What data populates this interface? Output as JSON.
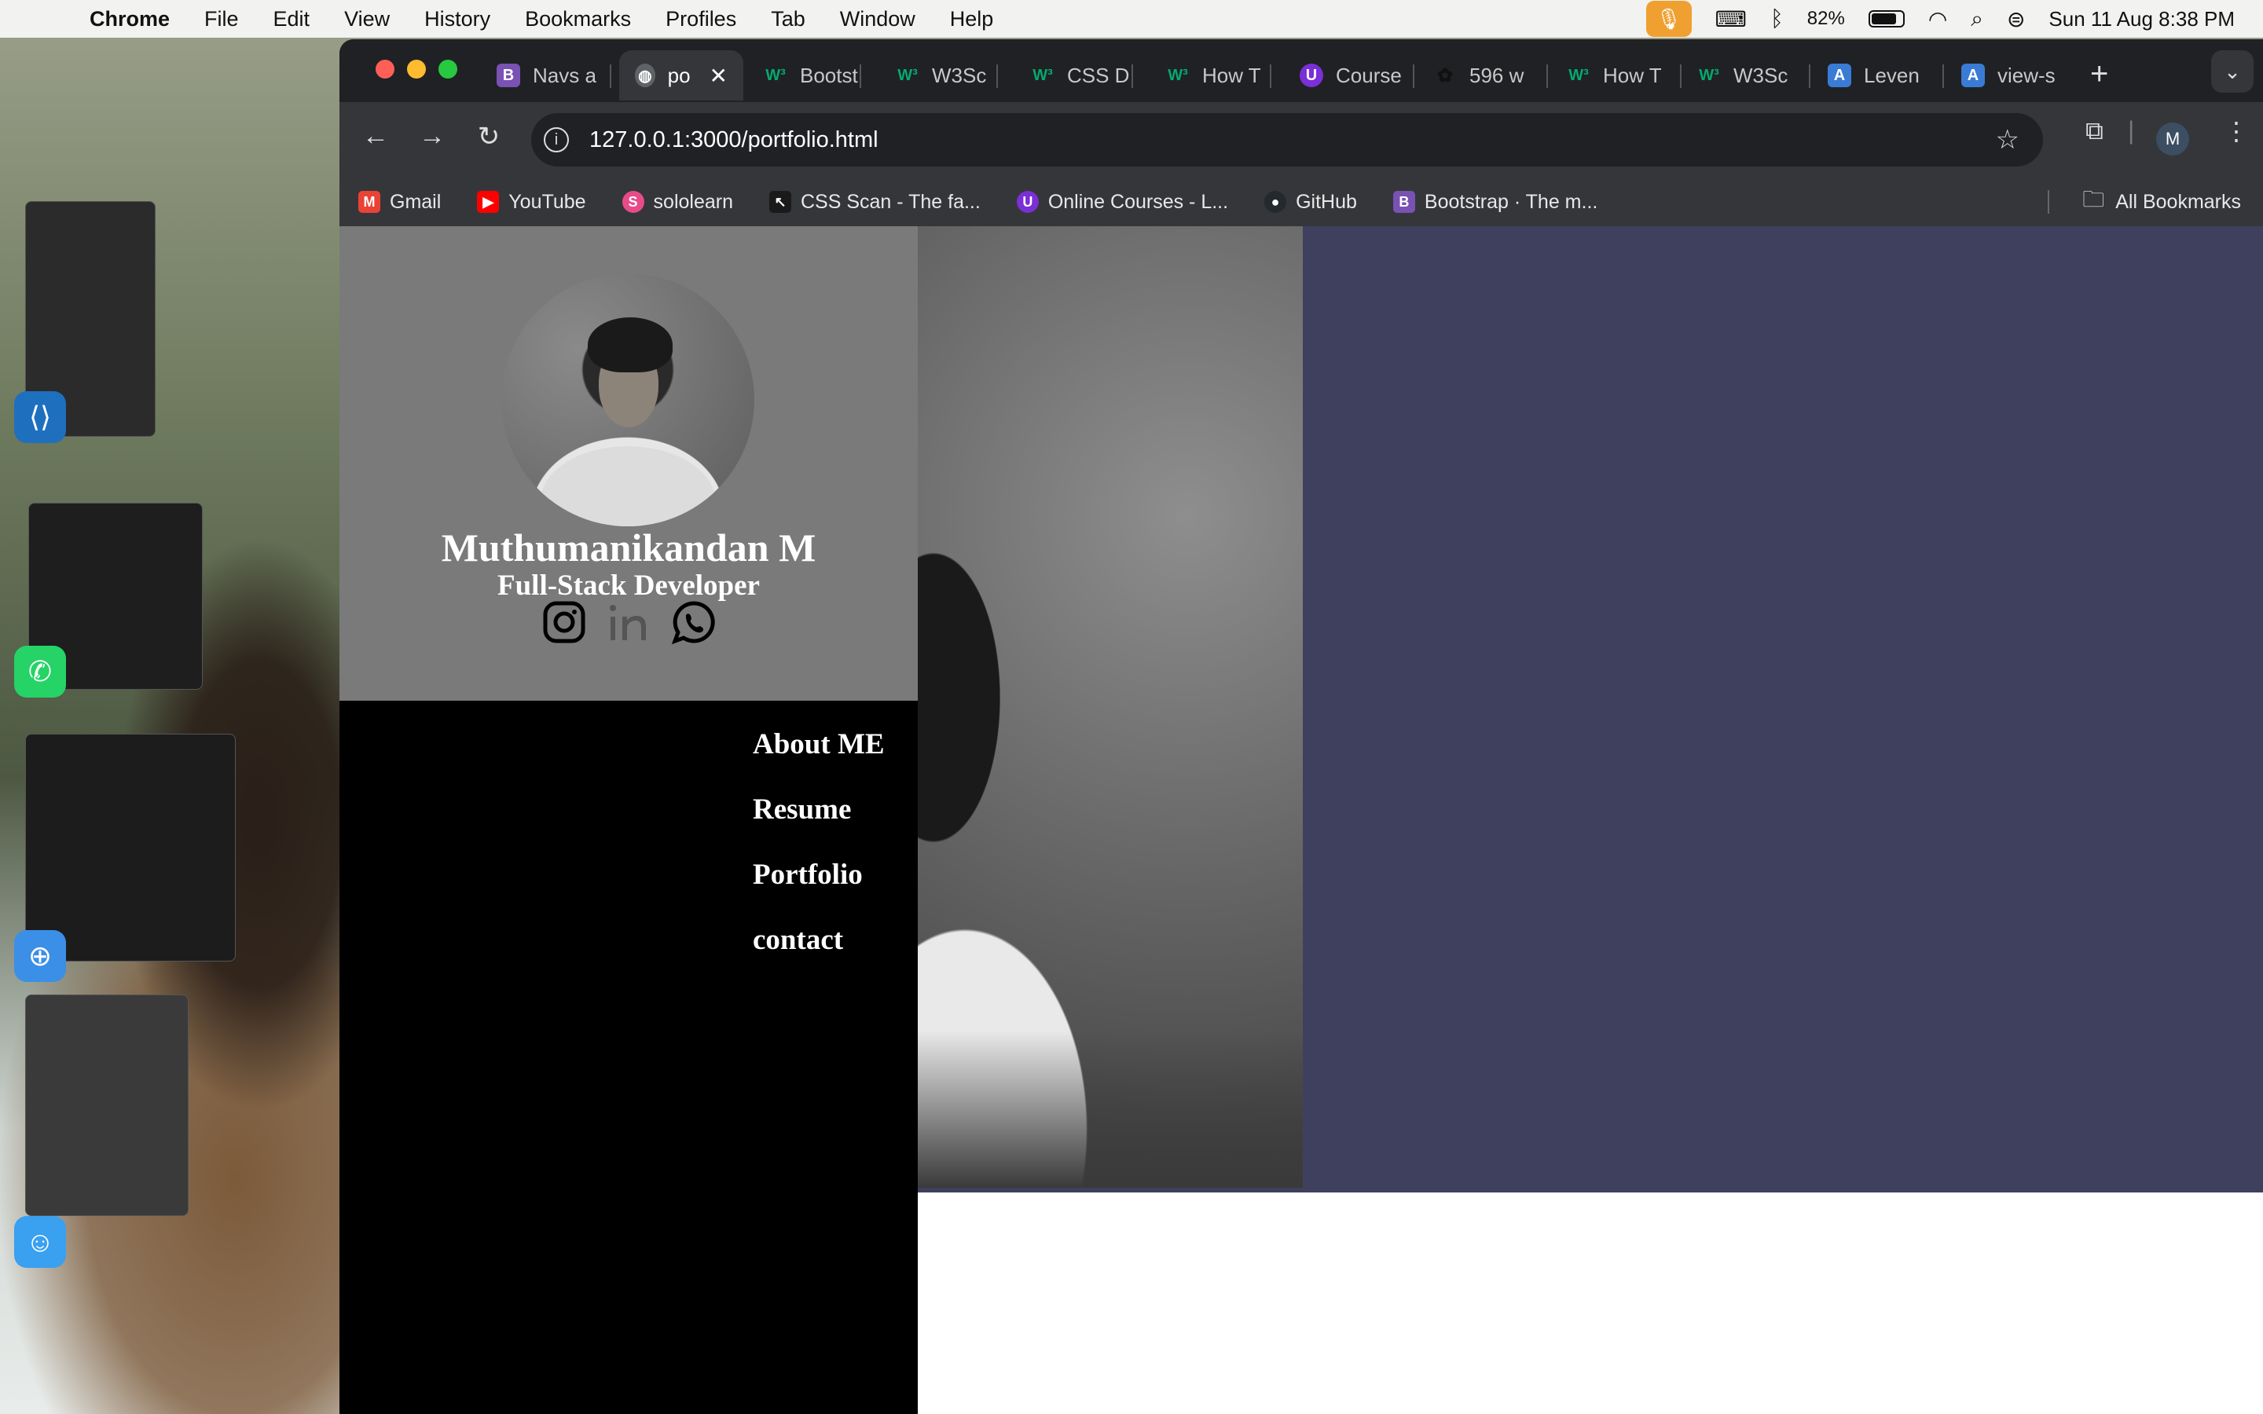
{
  "menubar": {
    "app": "Chrome",
    "items": [
      "File",
      "Edit",
      "View",
      "History",
      "Bookmarks",
      "Profiles",
      "Tab",
      "Window",
      "Help"
    ],
    "battery_percent": "82%",
    "battery_level": 0.82,
    "datetime": "Sun 11 Aug  8:38 PM"
  },
  "browser": {
    "tabs": [
      {
        "label": "Navs a",
        "icon": "B",
        "color": "#7952b3"
      },
      {
        "label": "po",
        "icon": "globe",
        "color": "#5f6368",
        "active": true
      },
      {
        "label": "Bootst",
        "icon": "W3",
        "color": "#04aa6d"
      },
      {
        "label": "W3Sc",
        "icon": "W3",
        "color": "#04aa6d"
      },
      {
        "label": "CSS D",
        "icon": "W3",
        "color": "#04aa6d"
      },
      {
        "label": "How T",
        "icon": "W3",
        "color": "#04aa6d"
      },
      {
        "label": "Course",
        "icon": "U",
        "color": "#7b2fd6"
      },
      {
        "label": "596 w",
        "icon": "ai",
        "color": "#202124"
      },
      {
        "label": "How T",
        "icon": "W3",
        "color": "#04aa6d"
      },
      {
        "label": "W3Sc",
        "icon": "W3",
        "color": "#04aa6d"
      },
      {
        "label": "Leven",
        "icon": "A",
        "color": "#3a7bd5"
      },
      {
        "label": "view-s",
        "icon": "A",
        "color": "#3a7bd5"
      }
    ],
    "url": "127.0.0.1:3000/portfolio.html",
    "profile_initial": "M",
    "bookmarks": [
      {
        "label": "Gmail",
        "color": "#ea4335",
        "icon": "M"
      },
      {
        "label": "YouTube",
        "color": "#ff0000",
        "icon": "▶"
      },
      {
        "label": "sololearn",
        "color": "#e94b8a",
        "icon": "S"
      },
      {
        "label": "CSS Scan - The fa...",
        "color": "#1a1a1a",
        "icon": "↖"
      },
      {
        "label": "Online Courses - L...",
        "color": "#7b2fd6",
        "icon": "U"
      },
      {
        "label": "GitHub",
        "color": "#24292e",
        "icon": "●"
      },
      {
        "label": "Bootstrap · The m...",
        "color": "#7952b3",
        "icon": "B"
      }
    ],
    "all_bookmarks": "All Bookmarks"
  },
  "page": {
    "name": "Muthumanikandan M",
    "role": "Full-Stack Developer",
    "socials": [
      "instagram-icon",
      "linkedin-icon",
      "whatsapp-icon"
    ],
    "nav": [
      "About ME",
      "Resume",
      "Portfolio",
      "contact"
    ],
    "colors": {
      "sidebar": "#000000",
      "card": "#7a7a7a",
      "panel": "#3f3f5e"
    }
  }
}
